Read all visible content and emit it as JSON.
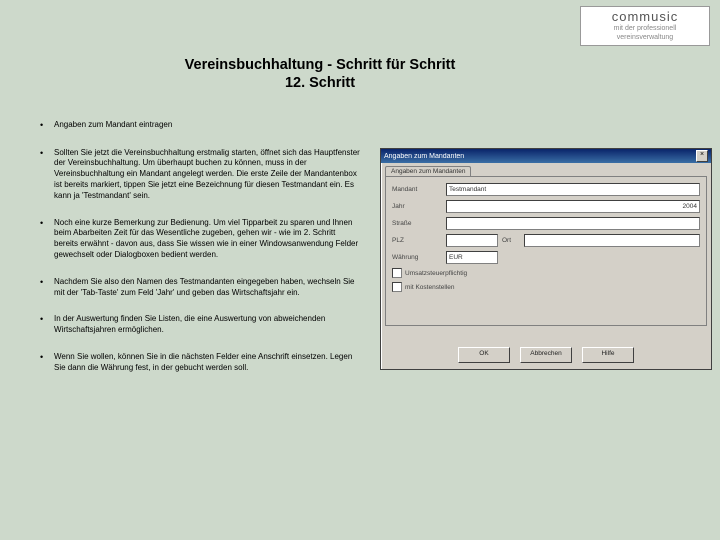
{
  "logo": {
    "brand": "commusic",
    "tag1": "mit der professionell",
    "tag2": "vereinsverwaltung"
  },
  "title": {
    "line1": "Vereinsbuchhaltung - Schritt für Schritt",
    "line2": "12. Schritt"
  },
  "bullets": [
    "Angaben zum Mandant eintragen",
    "Sollten Sie jetzt die Vereinsbuchhaltung erstmalig starten, öffnet sich das Hauptfenster der Vereinsbuchhaltung. Um überhaupt buchen zu können, muss in der Vereinsbuchhaltung ein Mandant angelegt werden. Die erste Zeile der Mandantenbox ist bereits markiert, tippen Sie jetzt eine Bezeichnung für diesen Testmandant ein. Es kann ja 'Testmandant' sein.",
    "Noch eine kurze Bemerkung zur Bedienung. Um viel Tipparbeit zu sparen und Ihnen beim Abarbeiten Zeit für das Wesentliche zugeben, gehen wir - wie im 2. Schritt bereits erwähnt - davon aus, dass Sie wissen wie in einer Windowsanwendung Felder gewechselt oder Dialogboxen bedient werden.",
    "Nachdem Sie also den Namen des Testmandanten eingegeben haben, wechseln Sie mit der 'Tab-Taste' zum Feld 'Jahr' und geben das Wirtschaftsjahr ein.",
    "In der Auswertung finden Sie Listen, die eine Auswertung von abweichenden Wirtschaftsjahren ermöglichen.",
    "Wenn Sie wollen, können Sie in die nächsten Felder eine Anschrift einsetzen. Legen Sie dann die Währung fest, in der gebucht werden soll."
  ],
  "dialog": {
    "title": "Angaben zum Mandanten",
    "tab": "Angaben zum Mandanten",
    "labels": {
      "mandant": "Mandant",
      "jahr": "Jahr",
      "strasse": "Straße",
      "plz": "PLZ",
      "ort": "Ort",
      "waehrung": "Währung",
      "wlabel": "EUR"
    },
    "values": {
      "mandant": "Testmandant",
      "jahr": "2004"
    },
    "checks": {
      "c1": "Umsatzsteuerpflichtig",
      "c2": "mit Kostenstellen"
    },
    "buttons": {
      "ok": "OK",
      "cancel": "Abbrechen",
      "help": "Hilfe"
    }
  }
}
